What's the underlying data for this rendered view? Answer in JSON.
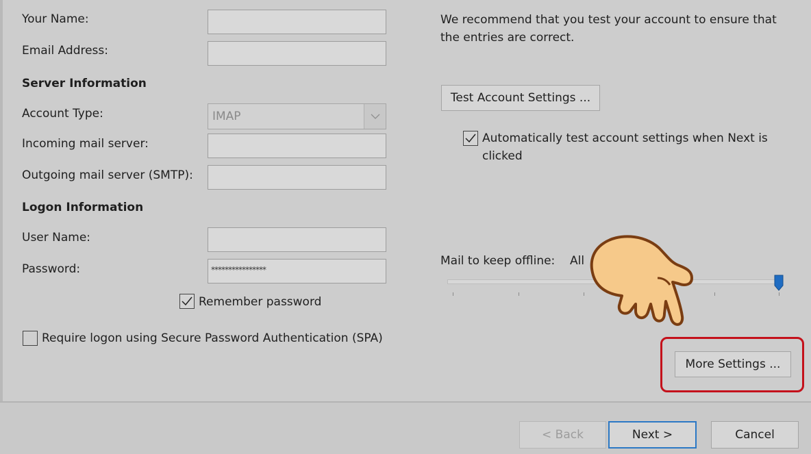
{
  "form": {
    "your_name_label": "Your Name:",
    "email_label": "Email Address:",
    "server_info_heading": "Server Information",
    "account_type_label": "Account Type:",
    "account_type_value": "IMAP",
    "incoming_label": "Incoming mail server:",
    "outgoing_label": "Outgoing mail server (SMTP):",
    "logon_info_heading": "Logon Information",
    "username_label": "User Name:",
    "password_label": "Password:",
    "password_mask": "****************",
    "remember_password_label": "Remember password",
    "remember_password_checked": true,
    "spa_label": "Require logon using Secure Password Authentication (SPA)",
    "spa_checked": false
  },
  "test": {
    "recommend_line1": "We recommend that you test your account to ensure that",
    "recommend_line2": "the entries are correct.",
    "test_button_label": "Test Account Settings ...",
    "auto_test_line1": "Automatically test account settings when Next is",
    "auto_test_line2": "clicked",
    "auto_test_checked": true
  },
  "offline": {
    "label": "Mail to keep offline:",
    "value": "All",
    "slider_fraction": 1.0
  },
  "more_settings_label": "More Settings ...",
  "footer": {
    "back_label": "< Back",
    "next_label": "Next >",
    "cancel_label": "Cancel"
  },
  "colors": {
    "highlight": "#c4111b",
    "accent": "#2b78c5",
    "pointer_hand": "#f6c98a"
  },
  "icons": {
    "pointer": "pointing-hand-icon",
    "checkmark": "checkmark-icon",
    "dropdown": "chevron-down-icon"
  }
}
